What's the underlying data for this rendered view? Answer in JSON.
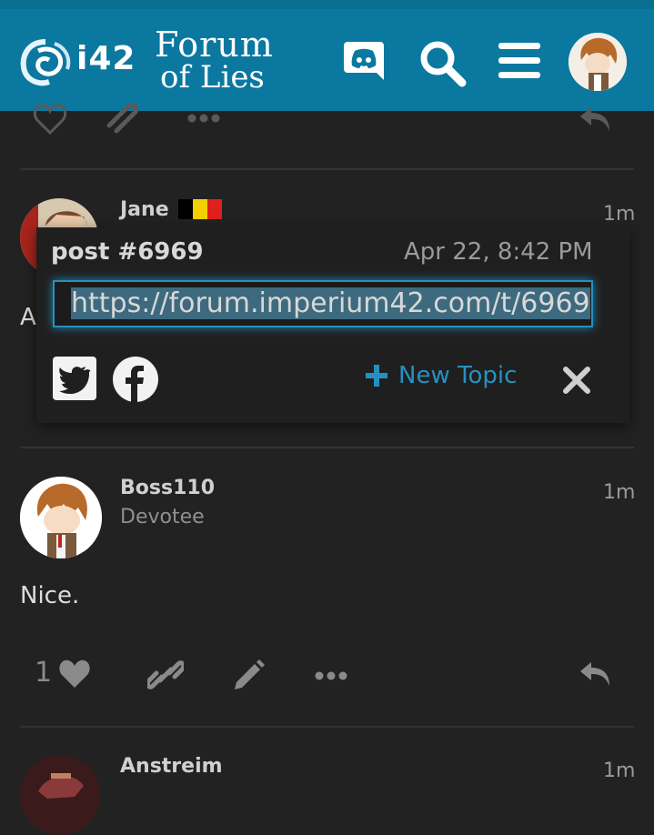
{
  "header": {
    "logo_text": "i42",
    "title_line1": "Forum",
    "title_line2": "of Lies",
    "icons": [
      "discord-icon",
      "search-icon",
      "menu-icon",
      "avatar"
    ]
  },
  "prev_post_actions": [
    "like-icon",
    "link-icon",
    "more-icon",
    "reply-icon"
  ],
  "post_jane": {
    "username": "Jane",
    "time": "1m",
    "body_fragment": "A"
  },
  "share_popup": {
    "title": "post #6969",
    "date": "Apr 22, 8:42 PM",
    "url": "https://forum.imperium42.com/t/6969",
    "new_topic_label": "New Topic"
  },
  "post_boss": {
    "username": "Boss110",
    "title": "Devotee",
    "time": "1m",
    "body": "Nice.",
    "like_count": "1"
  },
  "post_anstreim": {
    "username": "Anstreim",
    "time": "1m"
  },
  "colors": {
    "header_bg": "#0b78a0",
    "accent": "#2790c0",
    "page_bg": "#222222"
  }
}
